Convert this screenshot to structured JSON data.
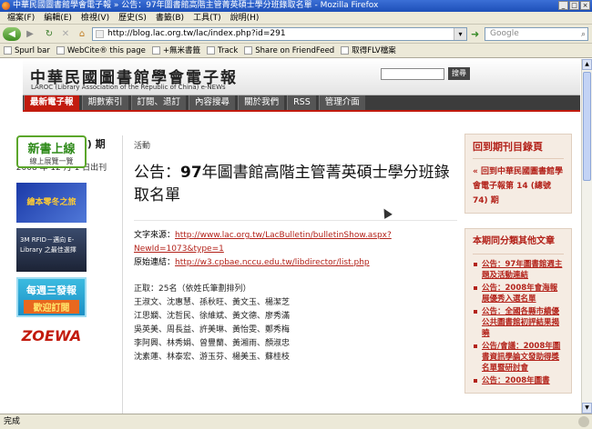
{
  "window": {
    "title": "中華民國圖書館學會電子報 » 公告：97年圖書館高階主管菁英碩士學分班錄取名單 - Mozilla Firefox",
    "status": "完成"
  },
  "menu": [
    "檔案(F)",
    "編輯(E)",
    "檢視(V)",
    "歷史(S)",
    "書籤(B)",
    "工具(T)",
    "說明(H)"
  ],
  "address": {
    "url": "http://blog.lac.org.tw/lac/index.php?id=291",
    "search_placeholder": "Google"
  },
  "bookmarks": [
    "Spurl bar",
    "WebCite® this page",
    "+無米書籤",
    "Track",
    "Share on FriendFeed",
    "取得FLV檔案"
  ],
  "site": {
    "logo_zh": "中華民國圖書館學會電子報",
    "logo_en": "LAROC (Library Association of the Republic of China) e-NEWs",
    "search_button": "搜尋",
    "nav": [
      "最新電子報",
      "期數索引",
      "訂閱、退訂",
      "內容搜尋",
      "關於我們",
      "RSS",
      "管理介面"
    ]
  },
  "left": {
    "issue_title": "第 14 (總號74) 期",
    "issue_date": "2008 年 12 月 1 日出刊",
    "banner1_main": "新書上線",
    "banner1_sub": "線上展覽一覽",
    "banner2_text": "繪本零冬之旅",
    "banner3_text": "3M RFID－邁向 E-Library 之最佳選擇",
    "banner4_main": "每週三發報",
    "banner4_sub": "歡迎訂閱",
    "banner5_text": "ZOEWA"
  },
  "article": {
    "crumb": "活動",
    "title_prefix": "公告：",
    "title_bold": "97",
    "title_rest": "年圖書館高階主管菁英碩士學分班錄取名單",
    "source_label": "文字來源：",
    "source_url": "http://www.lac.org.tw/LacBulletin/bulletinShow.aspx?NewId=1073&type=1",
    "origin_label": "原始連結：",
    "origin_url": "http://w3.cpbae.nccu.edu.tw/libdirector/list.php",
    "lines": [
      "正取：25名（依姓氏筆劃排列）",
      "王淑文、沈惠慧、孫秋旺、黃文玉、楊潔芝",
      "江思嫻、沈哲民、徐維斌、黃文德、廖秀滿",
      "吳英美、周長益、許美琳、黃怡雯、鄭秀梅",
      "李阿興、林秀娟、曾豐蘭、黃湘雨、顏淑忠",
      "沈素蓮、林泰宏、游玉芬、楊美玉、蘇桂枝"
    ]
  },
  "right": {
    "back_heading": "回到期刊目錄頁",
    "back_link": "« 回到中華民國圖書館學會電子報第 14 (總號74) 期",
    "other_heading": "本期同分類其他文章",
    "other_items": [
      "公告：97年圖書館週主題及活動連結",
      "公告：2008年會海報展優秀入選名單",
      "公告：全國各縣市績優公共圖書館初評結果揭曉",
      "公告/會議：2008年圖書資訊學論文發助得獎名單暨研討會",
      "公告：2008年圖書"
    ]
  }
}
